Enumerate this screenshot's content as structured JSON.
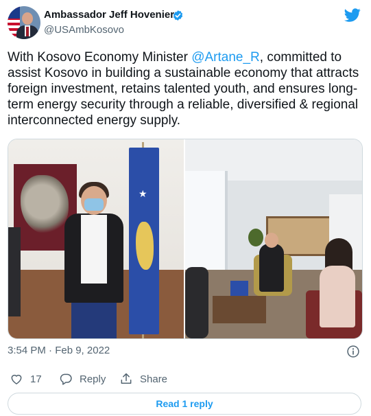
{
  "author": {
    "name": "Ambassador Jeff Hovenier",
    "handle": "@USAmbKosovo",
    "verified": true
  },
  "tweet": {
    "text_before": "With Kosovo Economy Minister ",
    "mention": "@Artane_R",
    "text_after": ", committed to assist Kosovo in building a sustainable economy that attracts foreign investment, retains talented youth, and ensures long-term energy security through a reliable, diversified & regional interconnected energy supply."
  },
  "meta": {
    "timestamp": "3:54 PM · Feb 9, 2022"
  },
  "actions": {
    "like_count": "17",
    "reply_label": "Reply",
    "share_label": "Share"
  },
  "thread": {
    "read_replies_label": "Read 1 reply"
  },
  "icons": {
    "brand": "twitter-bird-icon",
    "verified": "verified-badge-icon",
    "info": "info-icon",
    "like": "heart-icon",
    "reply": "reply-bubble-icon",
    "share": "share-upload-icon"
  },
  "colors": {
    "accent": "#1d9bf0",
    "text": "#0f1419",
    "secondary": "#536471",
    "border": "#cfd9de"
  }
}
